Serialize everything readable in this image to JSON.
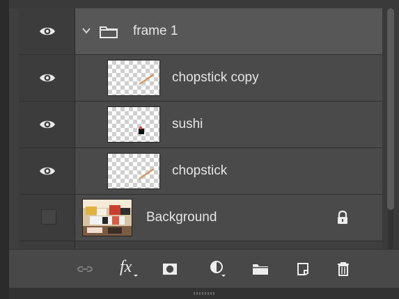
{
  "layers": [
    {
      "name": "frame 1",
      "type": "group",
      "visible": true,
      "selected": true,
      "icon": "folder-icon"
    },
    {
      "name": "chopstick copy",
      "type": "layer",
      "visible": true,
      "icon": "chopstick-thumbnail"
    },
    {
      "name": "sushi",
      "type": "layer",
      "visible": true,
      "icon": "sushi-thumbnail"
    },
    {
      "name": "chopstick",
      "type": "layer",
      "visible": true,
      "icon": "chopstick-thumbnail"
    },
    {
      "name": "Background",
      "type": "background",
      "visible": false,
      "locked": true,
      "icon": "background-thumbnail"
    }
  ],
  "toolbar": [
    {
      "name": "link-layers",
      "icon": "link-icon"
    },
    {
      "name": "add-layer-style",
      "icon": "fx-icon"
    },
    {
      "name": "add-mask",
      "icon": "mask-icon"
    },
    {
      "name": "new-fill-adjustment",
      "icon": "adjustment-icon"
    },
    {
      "name": "new-group",
      "icon": "folder-icon"
    },
    {
      "name": "new-layer",
      "icon": "new-layer-icon"
    },
    {
      "name": "delete-layer",
      "icon": "trash-icon"
    }
  ],
  "colors": {
    "panel": "#3f3f3f",
    "row": "#4a4a4a",
    "selected_row": "#575757",
    "text": "#e6e6e6"
  }
}
